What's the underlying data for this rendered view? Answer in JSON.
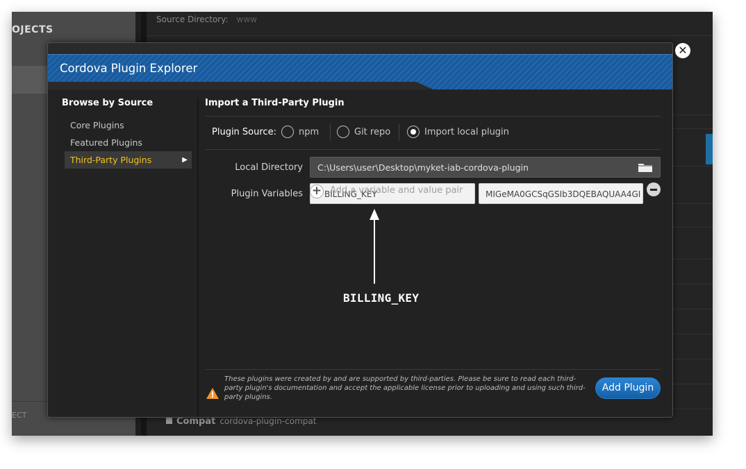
{
  "background": {
    "projects_heading": "OJECTS",
    "select_label": "ECT",
    "source_directory_label": "Source Directory:",
    "source_directory_value": "www",
    "compat_label": "Compat",
    "compat_plugin": "cordova-plugin-compat"
  },
  "modal": {
    "title": "Cordova Plugin Explorer",
    "close_icon": "close-icon",
    "header_color": "#1c5fa3",
    "sidebar": {
      "title": "Browse by Source",
      "items": [
        {
          "label": "Core Plugins",
          "active": false
        },
        {
          "label": "Featured Plugins",
          "active": false
        },
        {
          "label": "Third-Party Plugins",
          "active": true
        }
      ],
      "active_color": "#f0c420"
    },
    "main": {
      "title": "Import a Third-Party Plugin",
      "plugin_source_label": "Plugin Source:",
      "source_options": [
        {
          "label": "npm",
          "selected": false
        },
        {
          "label": "Git repo",
          "selected": false
        },
        {
          "label": "Import local plugin",
          "selected": true
        }
      ],
      "local_directory_label": "Local Directory",
      "local_directory_value": "C:\\Users\\user\\Desktop\\myket-iab-cordova-plugin",
      "plugin_variables_label": "Plugin Variables",
      "add_variable_placeholder": "Add a variable and value pair",
      "variable_name_value": "BILLING_KEY",
      "variable_value_value": "MIGeMA0GCSqGSIb3DQEBAQUAA4GI",
      "annotation_label": "BILLING_KEY",
      "warning_text": "These plugins were created by and are supported by third-parties. Please be sure to read each third-party plugin's documentation and accept the applicable license prior to uploading and using such third-party plugins.",
      "add_plugin_label": "Add Plugin",
      "accent_color": "#1e78c8"
    }
  }
}
